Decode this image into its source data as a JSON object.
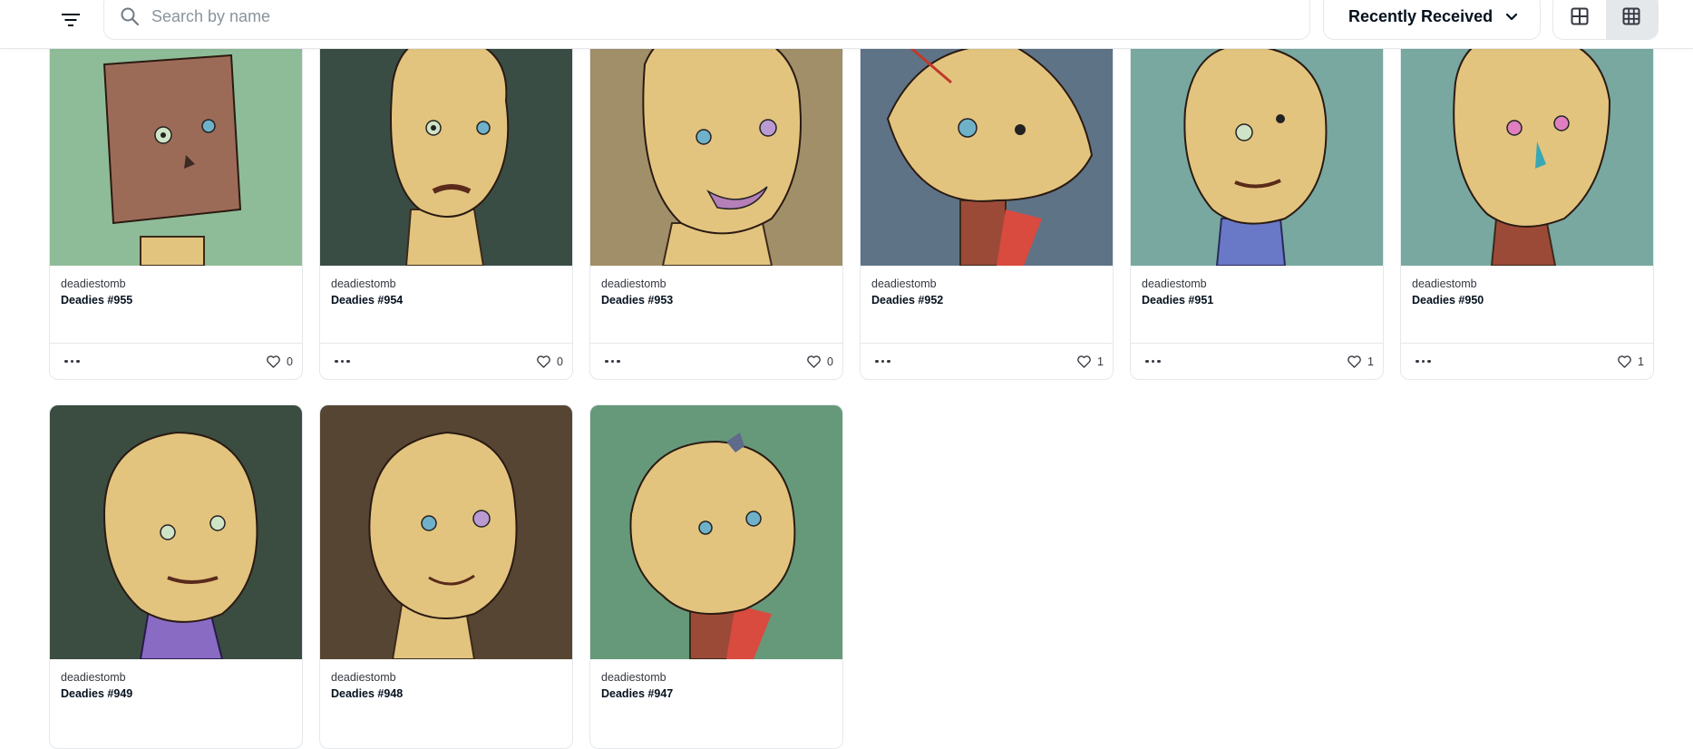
{
  "search": {
    "placeholder": "Search by name",
    "value": ""
  },
  "sort": {
    "label": "Recently Received"
  },
  "icons": {
    "filter": "filter-icon",
    "search": "search-icon",
    "sort_chevron": "chevron-down-icon",
    "grid_large": "grid-large-icon",
    "grid_small": "grid-small-icon",
    "more": "more-horizontal-icon",
    "heart": "heart-icon"
  },
  "view": {
    "active": "grid-small"
  },
  "items": [
    {
      "collection": "deadiestomb",
      "name": "Deadies #955",
      "likes": "0",
      "bg": "#8fbc98",
      "skull": "#9c6b58"
    },
    {
      "collection": "deadiestomb",
      "name": "Deadies #954",
      "likes": "0",
      "bg": "#3a4d45",
      "skull": "#e3c47f"
    },
    {
      "collection": "deadiestomb",
      "name": "Deadies #953",
      "likes": "0",
      "bg": "#a08f68",
      "skull": "#e3c47f"
    },
    {
      "collection": "deadiestomb",
      "name": "Deadies #952",
      "likes": "1",
      "bg": "#5f7386",
      "skull": "#e3c47f"
    },
    {
      "collection": "deadiestomb",
      "name": "Deadies #951",
      "likes": "1",
      "bg": "#78a8a0",
      "skull": "#e3c47f"
    },
    {
      "collection": "deadiestomb",
      "name": "Deadies #950",
      "likes": "1",
      "bg": "#78a8a0",
      "skull": "#e3c47f"
    },
    {
      "collection": "deadiestomb",
      "name": "Deadies #949",
      "likes": "",
      "bg": "#3a4d40",
      "skull": "#e3c47f"
    },
    {
      "collection": "deadiestomb",
      "name": "Deadies #948",
      "likes": "",
      "bg": "#574533",
      "skull": "#e3c47f"
    },
    {
      "collection": "deadiestomb",
      "name": "Deadies #947",
      "likes": "",
      "bg": "#66997a",
      "skull": "#e3c47f"
    }
  ]
}
